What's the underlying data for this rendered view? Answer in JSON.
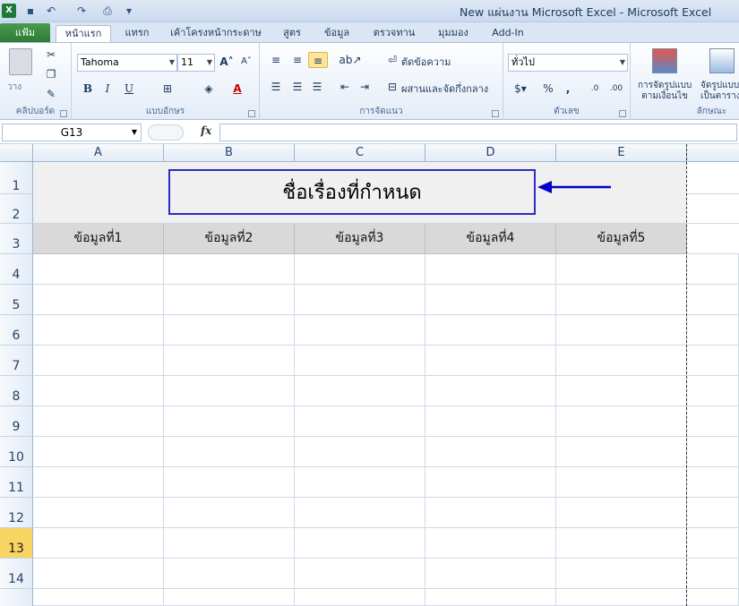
{
  "window": {
    "title": "New แผ่นงาน Microsoft Excel - Microsoft Excel"
  },
  "tabs": {
    "file": "แฟ้ม",
    "items": [
      "หน้าแรก",
      "แทรก",
      "เค้าโครงหน้ากระดาษ",
      "สูตร",
      "ข้อมูล",
      "ตรวจทาน",
      "มุมมอง",
      "Add-In"
    ]
  },
  "ribbon": {
    "clipboard": {
      "label": "คลิปบอร์ด",
      "paste": "วาง"
    },
    "font": {
      "label": "แบบอักษร",
      "name": "Tahoma",
      "size": "11"
    },
    "alignment": {
      "label": "การจัดแนว",
      "wrap": "ตัดข้อความ",
      "merge": "ผสานและจัดกึ่งกลาง"
    },
    "number": {
      "label": "ตัวเลข",
      "format": "ทั่วไป"
    },
    "styles": {
      "label": "ลักษณะ",
      "cond1": "การจัดรูปแบบ",
      "cond2": "ตามเงื่อนไข",
      "table1": "จัดรูปแบบ",
      "table2": "เป็นตาราง"
    }
  },
  "formula_bar": {
    "name_box": "G13",
    "fx": "fx",
    "value": ""
  },
  "sheet": {
    "columns": [
      "A",
      "B",
      "C",
      "D",
      "E"
    ],
    "rows": [
      "1",
      "2",
      "3",
      "4",
      "5",
      "6",
      "7",
      "8",
      "9",
      "10",
      "11",
      "12",
      "13",
      "14"
    ],
    "selected_row": "13",
    "title_text": "ชื่อเรื่องที่กำหนด",
    "headers": [
      "ข้อมูลที่1",
      "ข้อมูลที่2",
      "ข้อมูลที่3",
      "ข้อมูลที่4",
      "ข้อมูลที่5"
    ],
    "title_fill": "#f0f0f0",
    "header_fill": "#d9d9d9",
    "annotation_color": "#0000cc"
  }
}
